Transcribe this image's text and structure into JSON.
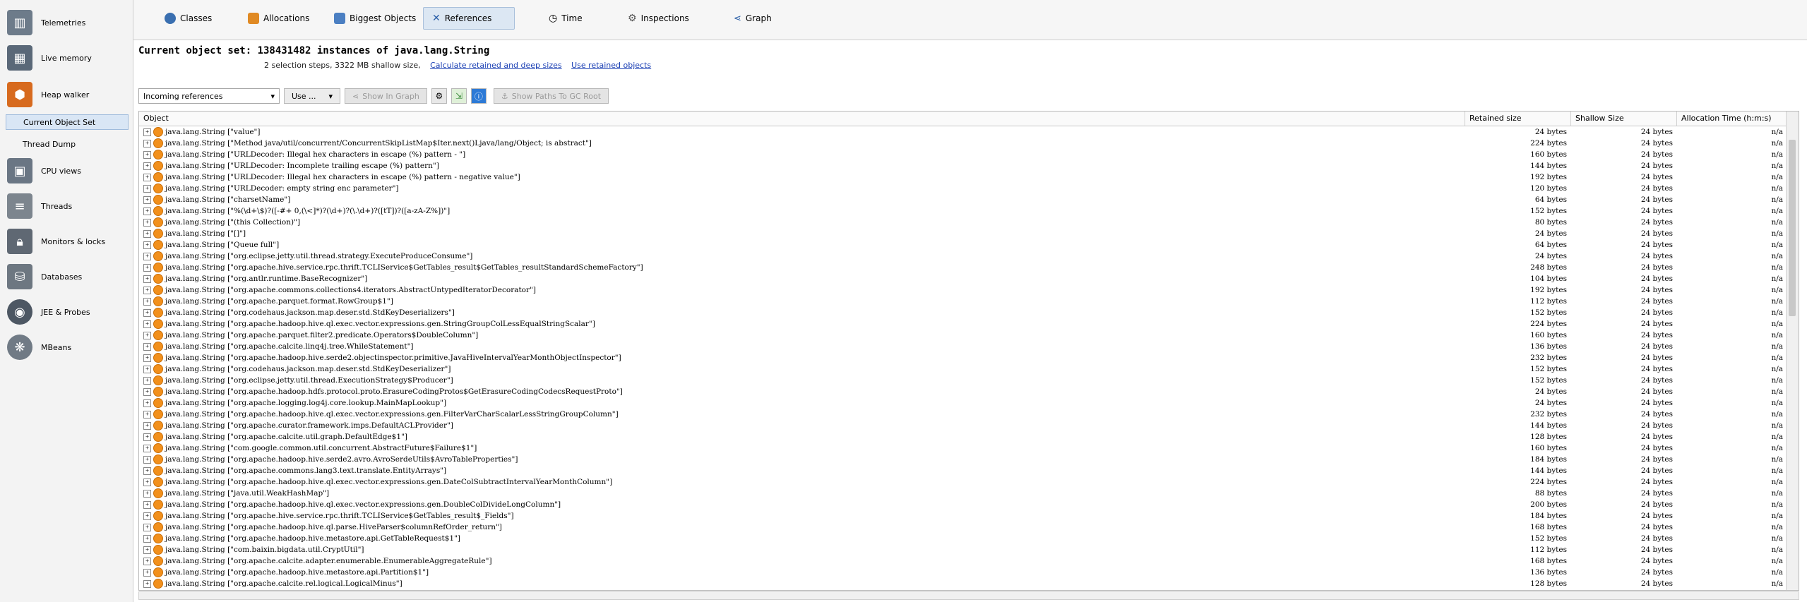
{
  "sidebar": {
    "items": [
      {
        "label": "Telemetries",
        "icon": "telemetries-icon",
        "color": "#6d7b8a"
      },
      {
        "label": "Live memory",
        "icon": "live-memory-icon",
        "color": "#5a6878"
      },
      {
        "label": "Heap walker",
        "icon": "heap-walker-icon",
        "color": "#d76a1e"
      },
      {
        "label": "CPU views",
        "icon": "cpu-views-icon",
        "color": "#6a7684"
      },
      {
        "label": "Threads",
        "icon": "threads-icon",
        "color": "#7c858e"
      },
      {
        "label": "Monitors & locks",
        "icon": "lock-icon",
        "color": "#5f6873"
      },
      {
        "label": "Databases",
        "icon": "database-icon",
        "color": "#6d7781"
      },
      {
        "label": "JEE & Probes",
        "icon": "probes-icon",
        "color": "#4d5763"
      },
      {
        "label": "MBeans",
        "icon": "mbeans-icon",
        "color": "#707a85"
      }
    ],
    "subitems": [
      {
        "label": "Current Object Set"
      },
      {
        "label": "Thread Dump"
      }
    ]
  },
  "tabs": [
    {
      "label": "Classes",
      "icon": "classes-icon"
    },
    {
      "label": "Allocations",
      "icon": "allocations-icon"
    },
    {
      "label": "Biggest Objects",
      "icon": "biggest-objects-icon"
    },
    {
      "label": "References",
      "icon": "references-icon"
    },
    {
      "label": "Time",
      "icon": "clock-icon"
    },
    {
      "label": "Inspections",
      "icon": "gear-icon"
    },
    {
      "label": "Graph",
      "icon": "graph-icon"
    }
  ],
  "header": {
    "title": "Current object set: 138431482 instances of java.lang.String",
    "subtitle": "2 selection steps, 3322 MB shallow size,",
    "link1": "Calculate retained and deep sizes",
    "link2": "Use retained objects"
  },
  "toolbar": {
    "select_value": "Incoming references",
    "use_label": "Use ...",
    "show_in_graph": "Show In Graph",
    "show_paths": "Show Paths To GC Root"
  },
  "table": {
    "columns": [
      "Object",
      "Retained size",
      "Shallow Size",
      "Allocation Time (h:m:s)"
    ],
    "rows": [
      {
        "obj": "java.lang.String [\"value\"]",
        "retained": "24 bytes",
        "shallow": "24 bytes",
        "time": "n/a"
      },
      {
        "obj": "java.lang.String [\"Method java/util/concurrent/ConcurrentSkipListMap$Iter.next()Ljava/lang/Object; is abstract\"]",
        "retained": "224 bytes",
        "shallow": "24 bytes",
        "time": "n/a"
      },
      {
        "obj": "java.lang.String [\"URLDecoder: Illegal hex characters in escape (%) pattern - \"]",
        "retained": "160 bytes",
        "shallow": "24 bytes",
        "time": "n/a"
      },
      {
        "obj": "java.lang.String [\"URLDecoder: Incomplete trailing escape (%) pattern\"]",
        "retained": "144 bytes",
        "shallow": "24 bytes",
        "time": "n/a"
      },
      {
        "obj": "java.lang.String [\"URLDecoder: Illegal hex characters in escape (%) pattern - negative value\"]",
        "retained": "192 bytes",
        "shallow": "24 bytes",
        "time": "n/a"
      },
      {
        "obj": "java.lang.String [\"URLDecoder: empty string enc parameter\"]",
        "retained": "120 bytes",
        "shallow": "24 bytes",
        "time": "n/a"
      },
      {
        "obj": "java.lang.String [\"charsetName\"]",
        "retained": "64 bytes",
        "shallow": "24 bytes",
        "time": "n/a"
      },
      {
        "obj": "java.lang.String [\"%(\\d+\\$)?([-#+ 0,(\\<]*)?(\\d+)?(\\.\\d+)?([tT])?([a-zA-Z%])\"]",
        "retained": "152 bytes",
        "shallow": "24 bytes",
        "time": "n/a"
      },
      {
        "obj": "java.lang.String [\"(this Collection)\"]",
        "retained": "80 bytes",
        "shallow": "24 bytes",
        "time": "n/a"
      },
      {
        "obj": "java.lang.String [\"[]\"]",
        "retained": "24 bytes",
        "shallow": "24 bytes",
        "time": "n/a"
      },
      {
        "obj": "java.lang.String [\"Queue full\"]",
        "retained": "64 bytes",
        "shallow": "24 bytes",
        "time": "n/a"
      },
      {
        "obj": "java.lang.String [\"org.eclipse.jetty.util.thread.strategy.ExecuteProduceConsume\"]",
        "retained": "24 bytes",
        "shallow": "24 bytes",
        "time": "n/a"
      },
      {
        "obj": "java.lang.String [\"org.apache.hive.service.rpc.thrift.TCLIService$GetTables_result$GetTables_resultStandardSchemeFactory\"]",
        "retained": "248 bytes",
        "shallow": "24 bytes",
        "time": "n/a"
      },
      {
        "obj": "java.lang.String [\"org.antlr.runtime.BaseRecognizer\"]",
        "retained": "104 bytes",
        "shallow": "24 bytes",
        "time": "n/a"
      },
      {
        "obj": "java.lang.String [\"org.apache.commons.collections4.iterators.AbstractUntypedIteratorDecorator\"]",
        "retained": "192 bytes",
        "shallow": "24 bytes",
        "time": "n/a"
      },
      {
        "obj": "java.lang.String [\"org.apache.parquet.format.RowGroup$1\"]",
        "retained": "112 bytes",
        "shallow": "24 bytes",
        "time": "n/a"
      },
      {
        "obj": "java.lang.String [\"org.codehaus.jackson.map.deser.std.StdKeyDeserializers\"]",
        "retained": "152 bytes",
        "shallow": "24 bytes",
        "time": "n/a"
      },
      {
        "obj": "java.lang.String [\"org.apache.hadoop.hive.ql.exec.vector.expressions.gen.StringGroupColLessEqualStringScalar\"]",
        "retained": "224 bytes",
        "shallow": "24 bytes",
        "time": "n/a"
      },
      {
        "obj": "java.lang.String [\"org.apache.parquet.filter2.predicate.Operators$DoubleColumn\"]",
        "retained": "160 bytes",
        "shallow": "24 bytes",
        "time": "n/a"
      },
      {
        "obj": "java.lang.String [\"org.apache.calcite.linq4j.tree.WhileStatement\"]",
        "retained": "136 bytes",
        "shallow": "24 bytes",
        "time": "n/a"
      },
      {
        "obj": "java.lang.String [\"org.apache.hadoop.hive.serde2.objectinspector.primitive.JavaHiveIntervalYearMonthObjectInspector\"]",
        "retained": "232 bytes",
        "shallow": "24 bytes",
        "time": "n/a"
      },
      {
        "obj": "java.lang.String [\"org.codehaus.jackson.map.deser.std.StdKeyDeserializer\"]",
        "retained": "152 bytes",
        "shallow": "24 bytes",
        "time": "n/a"
      },
      {
        "obj": "java.lang.String [\"org.eclipse.jetty.util.thread.ExecutionStrategy$Producer\"]",
        "retained": "152 bytes",
        "shallow": "24 bytes",
        "time": "n/a"
      },
      {
        "obj": "java.lang.String [\"org.apache.hadoop.hdfs.protocol.proto.ErasureCodingProtos$GetErasureCodingCodecsRequestProto\"]",
        "retained": "24 bytes",
        "shallow": "24 bytes",
        "time": "n/a"
      },
      {
        "obj": "java.lang.String [\"org.apache.logging.log4j.core.lookup.MainMapLookup\"]",
        "retained": "24 bytes",
        "shallow": "24 bytes",
        "time": "n/a"
      },
      {
        "obj": "java.lang.String [\"org.apache.hadoop.hive.ql.exec.vector.expressions.gen.FilterVarCharScalarLessStringGroupColumn\"]",
        "retained": "232 bytes",
        "shallow": "24 bytes",
        "time": "n/a"
      },
      {
        "obj": "java.lang.String [\"org.apache.curator.framework.imps.DefaultACLProvider\"]",
        "retained": "144 bytes",
        "shallow": "24 bytes",
        "time": "n/a"
      },
      {
        "obj": "java.lang.String [\"org.apache.calcite.util.graph.DefaultEdge$1\"]",
        "retained": "128 bytes",
        "shallow": "24 bytes",
        "time": "n/a"
      },
      {
        "obj": "java.lang.String [\"com.google.common.util.concurrent.AbstractFuture$Failure$1\"]",
        "retained": "160 bytes",
        "shallow": "24 bytes",
        "time": "n/a"
      },
      {
        "obj": "java.lang.String [\"org.apache.hadoop.hive.serde2.avro.AvroSerdeUtils$AvroTableProperties\"]",
        "retained": "184 bytes",
        "shallow": "24 bytes",
        "time": "n/a"
      },
      {
        "obj": "java.lang.String [\"org.apache.commons.lang3.text.translate.EntityArrays\"]",
        "retained": "144 bytes",
        "shallow": "24 bytes",
        "time": "n/a"
      },
      {
        "obj": "java.lang.String [\"org.apache.hadoop.hive.ql.exec.vector.expressions.gen.DateColSubtractIntervalYearMonthColumn\"]",
        "retained": "224 bytes",
        "shallow": "24 bytes",
        "time": "n/a"
      },
      {
        "obj": "java.lang.String [\"java.util.WeakHashMap\"]",
        "retained": "88 bytes",
        "shallow": "24 bytes",
        "time": "n/a"
      },
      {
        "obj": "java.lang.String [\"org.apache.hadoop.hive.ql.exec.vector.expressions.gen.DoubleColDivideLongColumn\"]",
        "retained": "200 bytes",
        "shallow": "24 bytes",
        "time": "n/a"
      },
      {
        "obj": "java.lang.String [\"org.apache.hive.service.rpc.thrift.TCLIService$GetTables_result$_Fields\"]",
        "retained": "184 bytes",
        "shallow": "24 bytes",
        "time": "n/a"
      },
      {
        "obj": "java.lang.String [\"org.apache.hadoop.hive.ql.parse.HiveParser$columnRefOrder_return\"]",
        "retained": "168 bytes",
        "shallow": "24 bytes",
        "time": "n/a"
      },
      {
        "obj": "java.lang.String [\"org.apache.hadoop.hive.metastore.api.GetTableRequest$1\"]",
        "retained": "152 bytes",
        "shallow": "24 bytes",
        "time": "n/a"
      },
      {
        "obj": "java.lang.String [\"com.baixin.bigdata.util.CryptUtil\"]",
        "retained": "112 bytes",
        "shallow": "24 bytes",
        "time": "n/a"
      },
      {
        "obj": "java.lang.String [\"org.apache.calcite.adapter.enumerable.EnumerableAggregateRule\"]",
        "retained": "168 bytes",
        "shallow": "24 bytes",
        "time": "n/a"
      },
      {
        "obj": "java.lang.String [\"org.apache.hadoop.hive.metastore.api.Partition$1\"]",
        "retained": "136 bytes",
        "shallow": "24 bytes",
        "time": "n/a"
      },
      {
        "obj": "java.lang.String [\"org.apache.calcite.rel.logical.LogicalMinus\"]",
        "retained": "128 bytes",
        "shallow": "24 bytes",
        "time": "n/a"
      }
    ]
  }
}
